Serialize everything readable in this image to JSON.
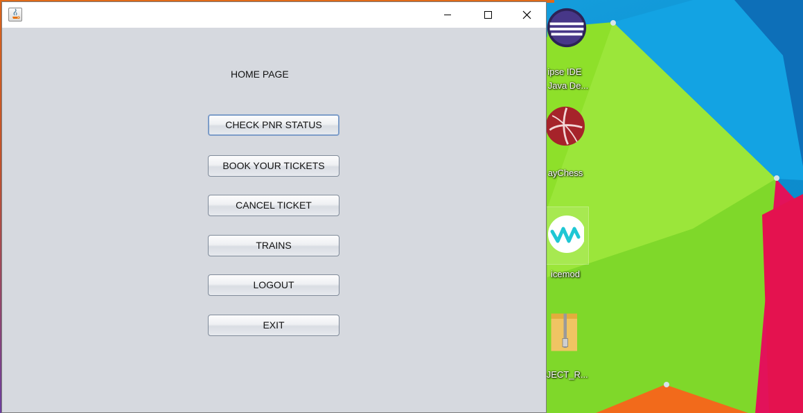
{
  "window": {
    "title": "",
    "page_title": "HOME PAGE",
    "buttons": [
      {
        "label": "CHECK PNR STATUS"
      },
      {
        "label": "BOOK YOUR TICKETS"
      },
      {
        "label": "CANCEL TICKET"
      },
      {
        "label": "TRAINS"
      },
      {
        "label": "LOGOUT"
      },
      {
        "label": "EXIT"
      }
    ]
  },
  "desktop": {
    "icons": [
      {
        "label_line1": "ipse IDE",
        "label_line2": "Java De...",
        "icon": "eclipse-icon"
      },
      {
        "label_line1": "ayChess",
        "icon": "chess-icon"
      },
      {
        "label_line1": "icemod",
        "icon": "voicemod-icon"
      },
      {
        "label_line1": "DJECT_R...",
        "icon": "zip-folder-icon"
      }
    ]
  },
  "colors": {
    "window_bg": "#d6d9df",
    "titlebar_bg": "#ffffff",
    "wallpaper_blue": "#19a7e3",
    "wallpaper_green": "#8ee02a",
    "wallpaper_orange": "#f26a1b",
    "wallpaper_pink": "#e4124f"
  }
}
